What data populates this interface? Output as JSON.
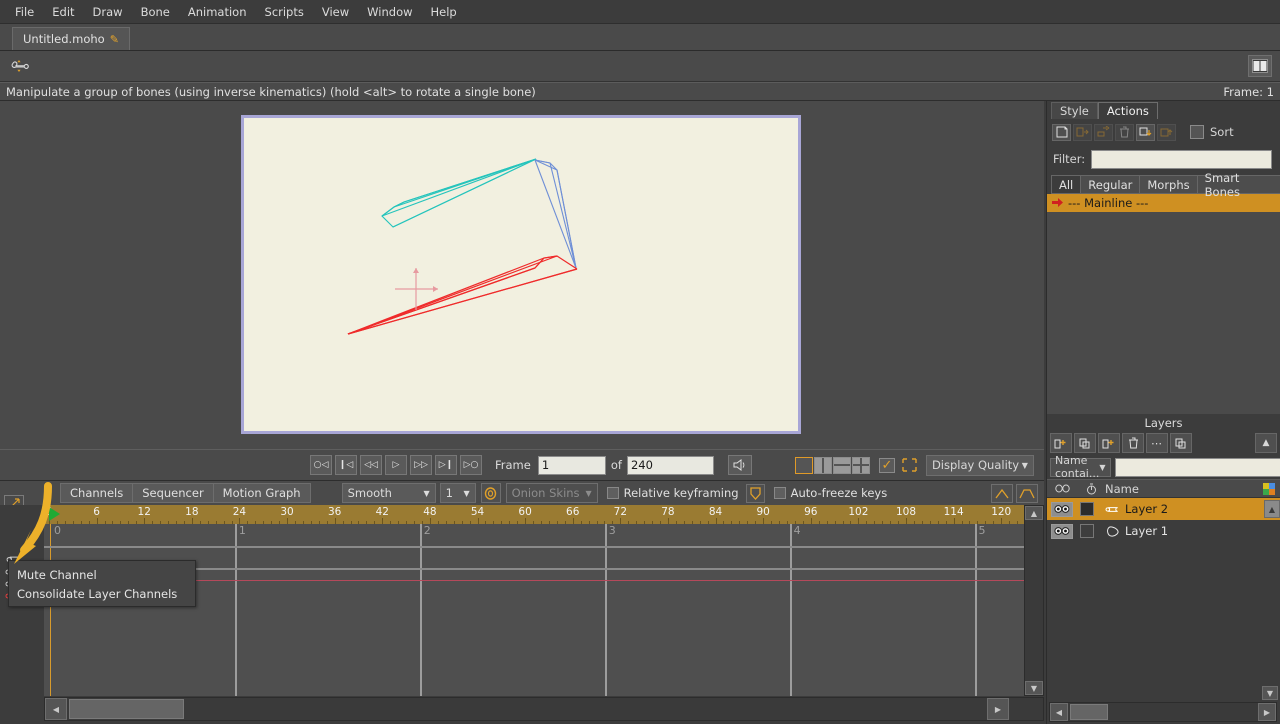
{
  "menubar": {
    "items": [
      {
        "label": "File"
      },
      {
        "label": "Edit"
      },
      {
        "label": "Draw"
      },
      {
        "label": "Bone"
      },
      {
        "label": "Animation"
      },
      {
        "label": "Scripts"
      },
      {
        "label": "View"
      },
      {
        "label": "Window"
      },
      {
        "label": "Help"
      }
    ]
  },
  "document_tab": {
    "title": "Untitled.moho",
    "modified_icon": "pencil-icon"
  },
  "toolbar": {
    "active_tool_icon": "manipulate-bones-icon",
    "panel_toggle_icon": "toggle-panels-icon"
  },
  "statusbar": {
    "hint": "Manipulate a group of bones (using inverse kinematics) (hold <alt> to rotate a single bone)",
    "frame_label": "Frame: 1"
  },
  "viewport": {
    "background_color": "#f2f0e0",
    "border_color": "#a8a6d6",
    "bones": [
      {
        "name": "bone-upper-arm",
        "color": "#25c4bc"
      },
      {
        "name": "bone-forearm",
        "color": "#6f8fd6"
      },
      {
        "name": "bone-selected",
        "color": "#ef2b2b"
      }
    ],
    "origin_marker": "origin-crosshair"
  },
  "playback": {
    "buttons": [
      {
        "name": "go-to-start-loop",
        "glyph": "◁",
        "icon": "rewind-loop-icon"
      },
      {
        "name": "go-to-beginning",
        "glyph": "◁",
        "icon": "skip-back-icon"
      },
      {
        "name": "step-back",
        "glyph": "◁◁",
        "icon": "step-back-icon"
      },
      {
        "name": "play",
        "glyph": "▷",
        "icon": "play-icon"
      },
      {
        "name": "step-forward",
        "glyph": "▷▷",
        "icon": "step-forward-icon"
      },
      {
        "name": "go-to-end",
        "glyph": "▷",
        "icon": "skip-forward-icon"
      },
      {
        "name": "play-loop",
        "glyph": "▷",
        "icon": "play-loop-icon"
      }
    ],
    "frame_label": "Frame",
    "frame_value": "1",
    "of_label": "of",
    "total_frames": "240",
    "audio_icon": "speaker-icon",
    "view_splits": [
      {
        "name": "single-view",
        "active": true
      },
      {
        "name": "two-column-view",
        "active": false
      },
      {
        "name": "two-row-view",
        "active": false
      },
      {
        "name": "quad-view",
        "active": false
      }
    ],
    "checkbox_checked": true,
    "crop_icon": "frame-crop-icon",
    "display_quality": "Display Quality"
  },
  "timeline_toolbar": {
    "tabs": [
      {
        "label": "Channels",
        "active": false
      },
      {
        "label": "Sequencer",
        "active": false
      },
      {
        "label": "Motion Graph",
        "active": false
      }
    ],
    "interpolation": "Smooth",
    "interp_count": "1",
    "onion_icon": "onion-skin-icon",
    "onion_skins": "Onion Skins",
    "relative_keyframing": {
      "label": "Relative keyframing",
      "checked": false
    },
    "shield_icon": "keyframe-shield-icon",
    "auto_freeze_keys": {
      "label": "Auto-freeze keys",
      "checked": false
    },
    "right_buttons": [
      {
        "name": "ease-in-button",
        "icon": "triangle-ease-icon"
      },
      {
        "name": "ease-both-button",
        "icon": "trapezoid-ease-icon"
      }
    ]
  },
  "timeline": {
    "ruler_ticks": [
      "0",
      "6",
      "12",
      "18",
      "24",
      "30",
      "36",
      "42",
      "48",
      "54",
      "60",
      "66",
      "72",
      "78",
      "84",
      "90",
      "96",
      "102",
      "108",
      "114",
      "120"
    ],
    "tick_step": 6,
    "max_frame": 120,
    "playhead_frame": 0,
    "playhead_icon": "green-play-marker",
    "graph_value_labels": [
      "0",
      "1",
      "2",
      "3",
      "4",
      "5"
    ],
    "channel_icons": [
      "bone-channel-icon",
      "sub-channel-icon",
      "sub-channel-icon",
      "sub-channel-icon"
    ]
  },
  "context_menu": {
    "items": [
      {
        "label": "Mute Channel"
      },
      {
        "label": "Consolidate Layer Channels"
      }
    ]
  },
  "annotation": {
    "arrow_color": "#edb12a",
    "name": "pointer-arrow-annotation"
  },
  "right_panel": {
    "tabs": [
      {
        "label": "Style",
        "active": false
      },
      {
        "label": "Actions",
        "active": true
      }
    ],
    "action_buttons": [
      {
        "name": "new-action-button",
        "icon": "new-action-icon",
        "enabled": true
      },
      {
        "name": "duplicate-action-button",
        "icon": "copy-action-icon",
        "enabled": false
      },
      {
        "name": "rename-action-button",
        "icon": "rename-action-icon",
        "enabled": false
      },
      {
        "name": "delete-action-button",
        "icon": "trash-icon",
        "enabled": false
      },
      {
        "name": "insert-action-button",
        "icon": "insert-action-icon",
        "enabled": true
      },
      {
        "name": "extract-action-button",
        "icon": "extract-action-icon",
        "enabled": false
      }
    ],
    "sort": {
      "label": "Sort",
      "checked": false
    },
    "filter_label": "Filter:",
    "filter_value": "",
    "category_tabs": [
      {
        "label": "All",
        "active": true
      },
      {
        "label": "Regular",
        "active": false
      },
      {
        "label": "Morphs",
        "active": false
      },
      {
        "label": "Smart Bones",
        "active": false
      }
    ],
    "action_rows": [
      {
        "label": "--- Mainline ---",
        "selected": true,
        "icon": "red-arrow-icon"
      }
    ]
  },
  "layers_panel": {
    "title": "Layers",
    "toolbar_buttons": [
      {
        "name": "new-vector-layer-button",
        "icon": "new-layer-icon"
      },
      {
        "name": "duplicate-layer-button",
        "icon": "duplicate-layer-icon"
      },
      {
        "name": "new-group-layer-button",
        "icon": "new-group-icon"
      },
      {
        "name": "delete-layer-button",
        "icon": "trash-icon"
      },
      {
        "name": "layer-options-button",
        "icon": "ellipsis-icon"
      },
      {
        "name": "layer-copy-button",
        "icon": "copy-layer-icon"
      },
      {
        "name": "collapse-panel-button",
        "icon": "chevron-up-icon"
      }
    ],
    "search_mode": "Name contai...",
    "search_value": "",
    "columns": [
      {
        "name": "visibility-column",
        "icon": "eye-icon"
      },
      {
        "name": "timing-column",
        "icon": "stopwatch-icon"
      },
      {
        "name": "name-column",
        "label": "Name"
      },
      {
        "name": "color-column",
        "icon": "color-swatch-icon"
      }
    ],
    "rows": [
      {
        "label": "Layer 2",
        "type_icon": "bone-layer-icon",
        "selected": true,
        "visible": true,
        "has_timing": true
      },
      {
        "label": "Layer 1",
        "type_icon": "vector-layer-icon",
        "selected": false,
        "visible": true,
        "has_timing": false
      }
    ]
  }
}
